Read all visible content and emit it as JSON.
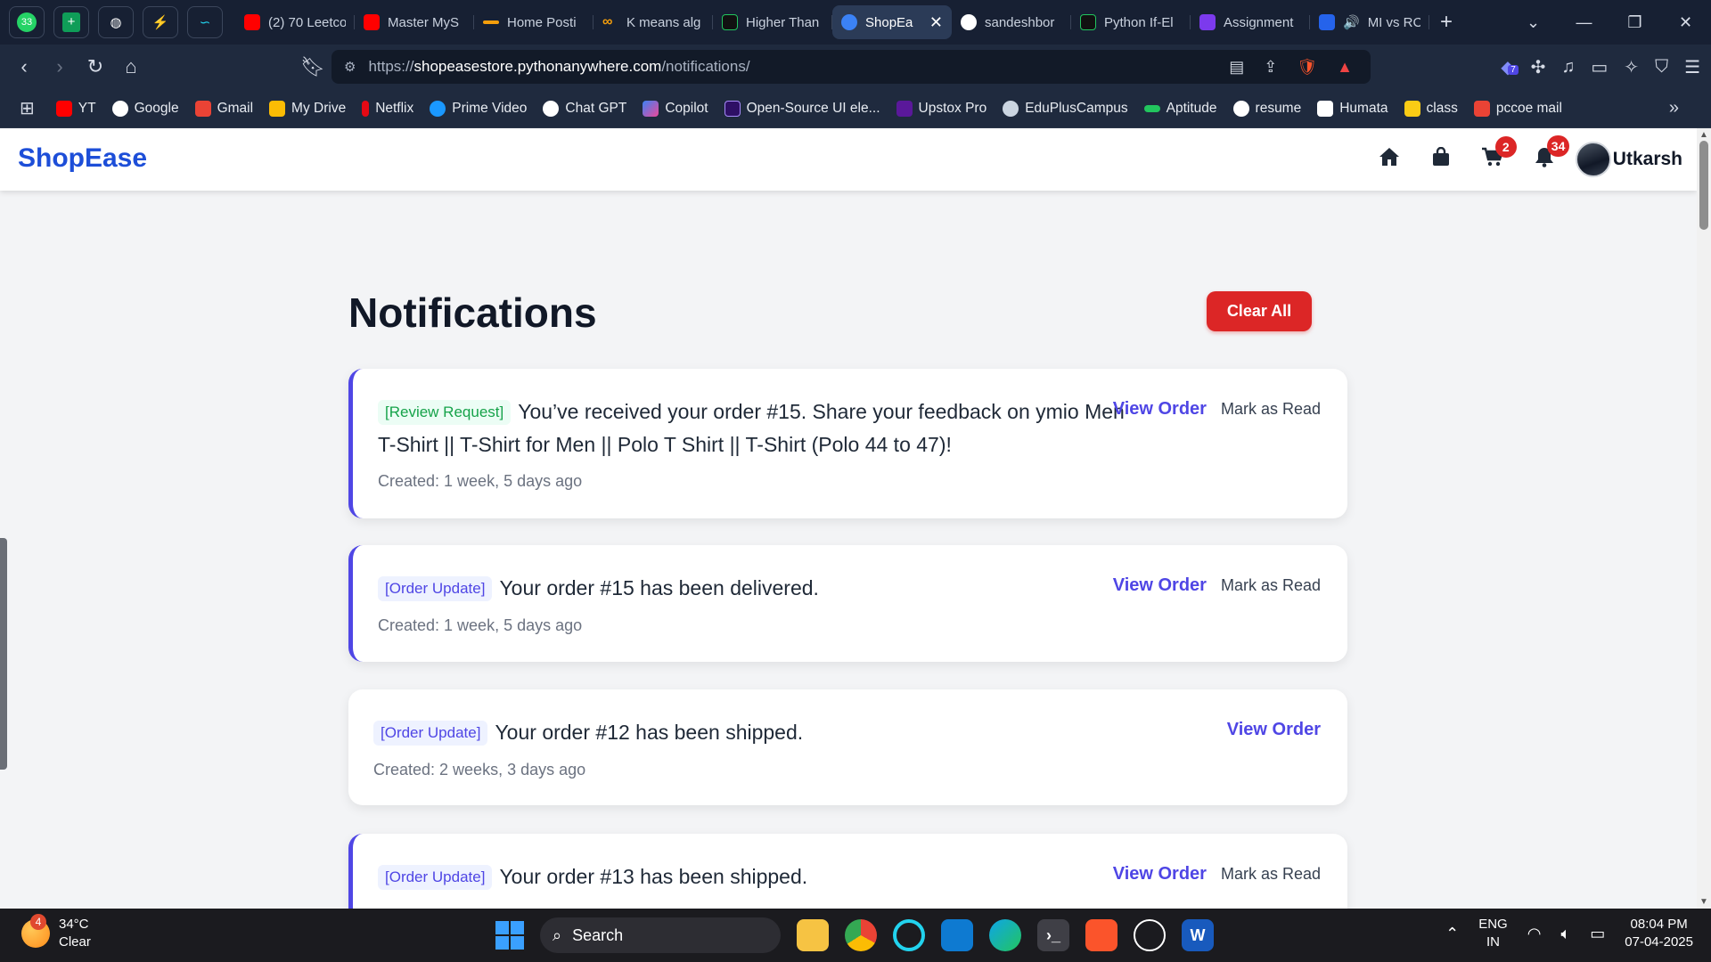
{
  "browser": {
    "pinned": [
      "33",
      "+",
      "◍",
      "⚡",
      "∽"
    ],
    "tabs": [
      {
        "title": "(2) 70 Leetco",
        "color": "#ff0000"
      },
      {
        "title": "Master MyS",
        "color": "#ff0000"
      },
      {
        "title": "Home Posti",
        "color": "#f59e0b"
      },
      {
        "title": "K means alg",
        "color": "#f59e0b"
      },
      {
        "title": "Higher Than",
        "color": "#111827"
      },
      {
        "title": "ShopEa",
        "color": "#3b82f6",
        "active": true
      },
      {
        "title": "sandeshbor",
        "color": "#ffffff"
      },
      {
        "title": "Python If-El",
        "color": "#111827"
      },
      {
        "title": "Assignment",
        "color": "#7c3aed"
      },
      {
        "title": "MI vs RC",
        "color": "#2563eb"
      }
    ],
    "close_tab_symbol": "✕",
    "new_tab_symbol": "+",
    "window_controls": [
      "⌄",
      "—",
      "❐",
      "✕"
    ],
    "url_prefix": "https://",
    "url_host": "shopeasestore.pythonanywhere.com",
    "url_path": "/notifications/",
    "extension_badge": "7",
    "bookmarks": [
      {
        "label": "YT",
        "color": "#ff0000"
      },
      {
        "label": "Google",
        "color": "#ffffff"
      },
      {
        "label": "Gmail",
        "color": "#ea4335"
      },
      {
        "label": "My Drive",
        "color": "#fbbc04"
      },
      {
        "label": "Netflix",
        "color": "#e50914"
      },
      {
        "label": "Prime Video",
        "color": "#1a98ff"
      },
      {
        "label": "Chat GPT",
        "color": "#ffffff"
      },
      {
        "label": "Copilot",
        "color": "#7c3aed"
      },
      {
        "label": "Open-Source UI ele...",
        "color": "#6d28d9"
      },
      {
        "label": "Upstox Pro",
        "color": "#5a189a"
      },
      {
        "label": "EduPlusCampus",
        "color": "#cbd5e1"
      },
      {
        "label": "Aptitude",
        "color": "#22c55e"
      },
      {
        "label": "resume",
        "color": "#ffffff"
      },
      {
        "label": "Humata",
        "color": "#ffffff"
      },
      {
        "label": "class",
        "color": "#facc15"
      },
      {
        "label": "pccoe mail",
        "color": "#ea4335"
      }
    ]
  },
  "site": {
    "brand": "ShopEase",
    "cart_count": "2",
    "notification_count": "34",
    "user_name": "Utkarsh"
  },
  "main": {
    "title": "Notifications",
    "clear_all_label": "Clear All",
    "view_order_label": "View Order",
    "mark_read_label": "Mark as Read",
    "notifications": [
      {
        "tag": "[Review Request]",
        "message": "You’ve received your order #15. Share your feedback on ymio Men T-Shirt || T-Shirt for Men || Polo T Shirt || T-Shirt (Polo 44 to 47)!",
        "created": "Created: 1 week, 5 days ago",
        "unread": true
      },
      {
        "tag": "[Order Update]",
        "message": "Your order #15 has been delivered.",
        "created": "Created: 1 week, 5 days ago",
        "unread": true
      },
      {
        "tag": "[Order Update]",
        "message": "Your order #12 has been shipped.",
        "created": "Created: 2 weeks, 3 days ago",
        "unread": false
      },
      {
        "tag": "[Order Update]",
        "message": "Your order #13 has been shipped.",
        "created": "",
        "unread": true
      }
    ]
  },
  "taskbar": {
    "weather_badge": "4",
    "temperature": "34°C",
    "condition": "Clear",
    "search_placeholder": "Search",
    "lang_line1": "ENG",
    "lang_line2": "IN",
    "time": "08:04 PM",
    "date": "07-04-2025"
  }
}
